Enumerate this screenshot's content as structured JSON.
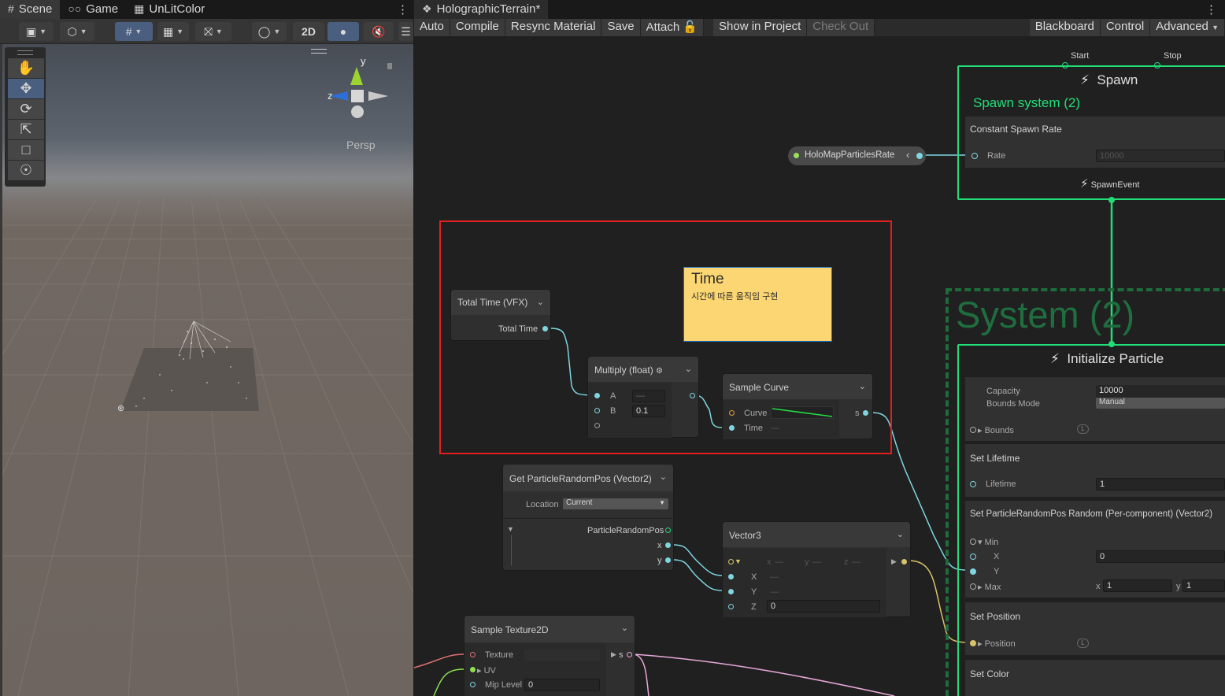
{
  "scene_window": {
    "tabs": [
      {
        "label": "Scene",
        "icon": "hash-icon"
      },
      {
        "label": "Game",
        "icon": "gamepad-icon"
      },
      {
        "label": "UnLitColor",
        "icon": "package-icon"
      }
    ],
    "toolbar": {
      "two_d_label": "2D"
    },
    "gizmo": {
      "axis_y": "y",
      "axis_z": "z",
      "projection": "Persp"
    }
  },
  "graph_window": {
    "tab_title": "HolographicTerrain*",
    "toolbar": {
      "auto": "Auto",
      "compile": "Compile",
      "resync": "Resync Material",
      "save": "Save",
      "attach": "Attach",
      "show_in_project": "Show in Project",
      "check_out": "Check Out",
      "blackboard": "Blackboard",
      "control": "Control",
      "advanced": "Advanced"
    },
    "spawn": {
      "start": "Start",
      "stop": "Stop",
      "title": "Spawn",
      "system_name": "Spawn system (2)",
      "block_title": "Constant Spawn Rate",
      "rate_label": "Rate",
      "rate_value": "10000",
      "event": "SpawnEvent"
    },
    "property_node": {
      "name": "HoloMapParticlesRate"
    },
    "system_label": "System (2)",
    "initialize": {
      "title": "Initialize Particle",
      "capacity_label": "Capacity",
      "capacity_value": "10000",
      "bounds_mode_label": "Bounds Mode",
      "bounds_mode_value": "Manual",
      "bounds_label": "Bounds",
      "bounds_badge": "L"
    },
    "set_lifetime": {
      "title": "Set Lifetime",
      "label": "Lifetime",
      "value": "1"
    },
    "set_random_pos": {
      "title": "Set ParticleRandomPos Random (Per-component) (Vector2)",
      "min_label": "Min",
      "x_label": "X",
      "x_value": "0",
      "y_label": "Y",
      "max_label": "Max",
      "max_x_label": "x",
      "max_x_value": "1",
      "max_y_label": "y",
      "max_y_value": "1"
    },
    "set_position": {
      "title": "Set Position",
      "label": "Position",
      "badge": "L"
    },
    "set_color": {
      "title": "Set Color"
    },
    "total_time": {
      "title": "Total Time (VFX)",
      "output": "Total Time"
    },
    "sticky_note": {
      "title": "Time",
      "body": "시간에 따른 움직임 구현"
    },
    "multiply": {
      "title": "Multiply (float)",
      "a_label": "A",
      "a_value": "—",
      "b_label": "B",
      "b_value": "0.1"
    },
    "sample_curve": {
      "title": "Sample Curve",
      "curve_label": "Curve",
      "time_label": "Time",
      "time_value": "—",
      "out_label": "s"
    },
    "get_random_pos": {
      "title": "Get ParticleRandomPos (Vector2)",
      "location_label": "Location",
      "location_value": "Current",
      "out_label": "ParticleRandomPos",
      "x_label": "x",
      "y_label": "y"
    },
    "vector3": {
      "title": "Vector3",
      "x_label": "X",
      "y_label": "Y",
      "z_label": "Z",
      "x_value": "—",
      "y_value": "—",
      "z_value": "0",
      "hx": "x",
      "hy": "y",
      "hz": "z",
      "h_value": "—"
    },
    "sample_texture": {
      "title": "Sample Texture2D",
      "texture_label": "Texture",
      "uv_label": "UV",
      "mip_label": "Mip Level",
      "mip_value": "0",
      "out_label": "s"
    }
  },
  "colors": {
    "context_green": "#22dd77",
    "selection_red": "#e02020",
    "sticky": "#fcd672",
    "wire_cyan": "#7fd6e0"
  }
}
